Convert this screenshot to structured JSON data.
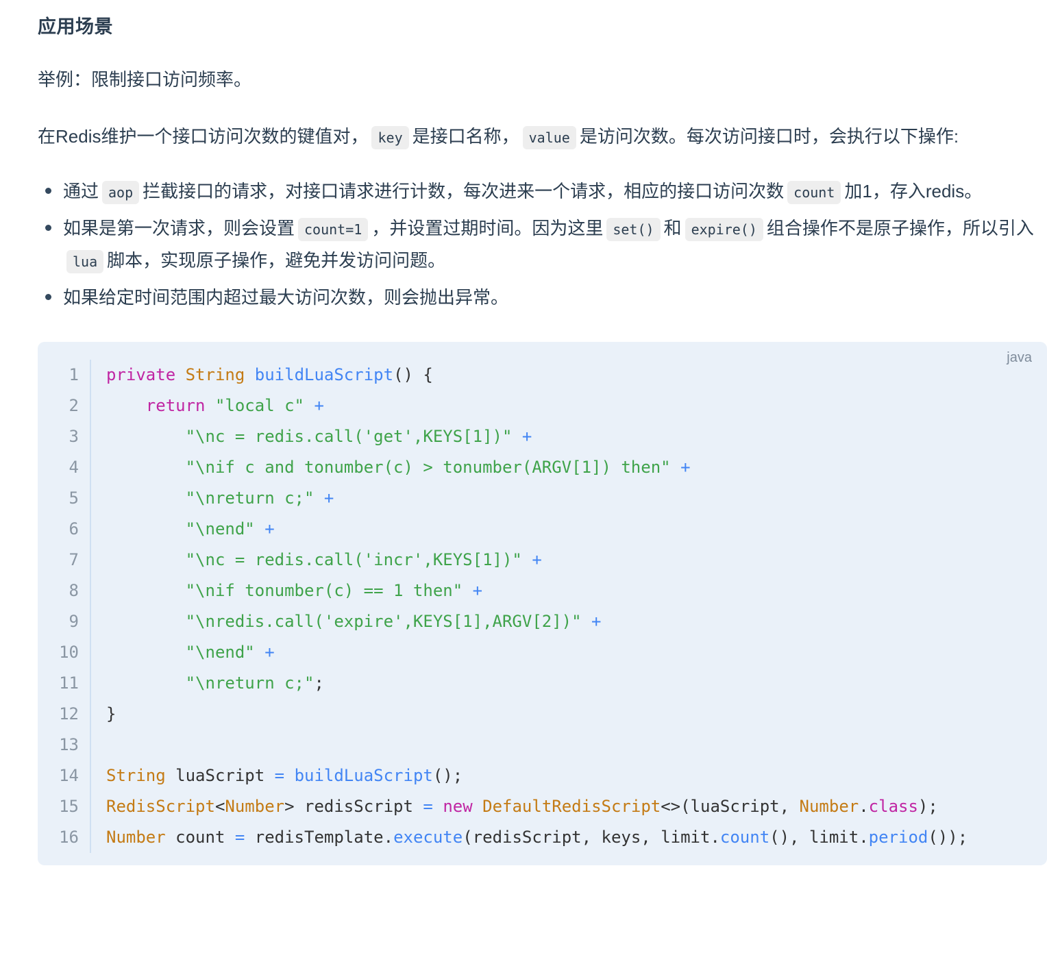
{
  "article": {
    "heading": "应用场景",
    "intro": "举例：限制接口访问频率。",
    "paragraph": {
      "part1": "在Redis维护一个接口访问次数的键值对，",
      "chip1": "key",
      "part2": "是接口名称，",
      "chip2": "value",
      "part3": "是访问次数。每次访问接口时，会执行以下操作:"
    },
    "bullets": [
      {
        "part1": "通过",
        "chip1": "aop",
        "part2": "拦截接口的请求，对接口请求进行计数，每次进来一个请求，相应的接口访问次数",
        "chip2": "count",
        "part3": "加1，存入redis。"
      },
      {
        "part1": "如果是第一次请求，则会设置",
        "chip1": "count=1",
        "part2": "，并设置过期时间。因为这里",
        "chip2": "set()",
        "part3": "和",
        "chip3": "expire()",
        "part4": "组合操作不是原子操作，所以引入",
        "chip4": "lua",
        "part5": "脚本，实现原子操作，避免并发访问问题。"
      },
      {
        "part1": "如果给定时间范围内超过最大访问次数，则会抛出异常。"
      }
    ]
  },
  "code_block": {
    "language_label": "java",
    "line_numbers": [
      "1",
      "2",
      "3",
      "4",
      "5",
      "6",
      "7",
      "8",
      "9",
      "10",
      "11",
      "12",
      "13",
      "14",
      "15",
      "16"
    ],
    "lines": [
      {
        "n": "1",
        "text": "private String buildLuaScript() {"
      },
      {
        "n": "2",
        "text": "    return \"local c\" +"
      },
      {
        "n": "3",
        "text": "        \"\\nc = redis.call('get',KEYS[1])\" +"
      },
      {
        "n": "4",
        "text": "        \"\\nif c and tonumber(c) > tonumber(ARGV[1]) then\" +"
      },
      {
        "n": "5",
        "text": "        \"\\nreturn c;\" +"
      },
      {
        "n": "6",
        "text": "        \"\\nend\" +"
      },
      {
        "n": "7",
        "text": "        \"\\nc = redis.call('incr',KEYS[1])\" +"
      },
      {
        "n": "8",
        "text": "        \"\\nif tonumber(c) == 1 then\" +"
      },
      {
        "n": "9",
        "text": "        \"\\nredis.call('expire',KEYS[1],ARGV[2])\" +"
      },
      {
        "n": "10",
        "text": "        \"\\nend\" +"
      },
      {
        "n": "11",
        "text": "        \"\\nreturn c;\";"
      },
      {
        "n": "12",
        "text": "}"
      },
      {
        "n": "13",
        "text": ""
      },
      {
        "n": "14",
        "text": "String luaScript = buildLuaScript();"
      },
      {
        "n": "15",
        "text": "RedisScript<Number> redisScript = new DefaultRedisScript<>(luaScript, Number.class);"
      },
      {
        "n": "16",
        "text": "Number count = redisTemplate.execute(redisScript, keys, limit.count(), limit.period());"
      }
    ],
    "tokens": {
      "l1": [
        [
          "private",
          "kw"
        ],
        [
          " ",
          "plain"
        ],
        [
          "String",
          "type"
        ],
        [
          " ",
          "plain"
        ],
        [
          "buildLuaScript",
          "fn"
        ],
        [
          "() {",
          "plain"
        ]
      ],
      "l2": [
        [
          "    ",
          "plain"
        ],
        [
          "return",
          "kw"
        ],
        [
          " ",
          "plain"
        ],
        [
          "\"local c\"",
          "str"
        ],
        [
          " ",
          "plain"
        ],
        [
          "+",
          "op"
        ]
      ],
      "l3": [
        [
          "        ",
          "plain"
        ],
        [
          "\"\\nc = redis.call('get',KEYS[1])\"",
          "str"
        ],
        [
          " ",
          "plain"
        ],
        [
          "+",
          "op"
        ]
      ],
      "l4": [
        [
          "        ",
          "plain"
        ],
        [
          "\"\\nif c and tonumber(c) > tonumber(ARGV[1]) then\"",
          "str"
        ],
        [
          " ",
          "plain"
        ],
        [
          "+",
          "op"
        ]
      ],
      "l5": [
        [
          "        ",
          "plain"
        ],
        [
          "\"\\nreturn c;\"",
          "str"
        ],
        [
          " ",
          "plain"
        ],
        [
          "+",
          "op"
        ]
      ],
      "l6": [
        [
          "        ",
          "plain"
        ],
        [
          "\"\\nend\"",
          "str"
        ],
        [
          " ",
          "plain"
        ],
        [
          "+",
          "op"
        ]
      ],
      "l7": [
        [
          "        ",
          "plain"
        ],
        [
          "\"\\nc = redis.call('incr',KEYS[1])\"",
          "str"
        ],
        [
          " ",
          "plain"
        ],
        [
          "+",
          "op"
        ]
      ],
      "l8": [
        [
          "        ",
          "plain"
        ],
        [
          "\"\\nif tonumber(c) == 1 then\"",
          "str"
        ],
        [
          " ",
          "plain"
        ],
        [
          "+",
          "op"
        ]
      ],
      "l9": [
        [
          "        ",
          "plain"
        ],
        [
          "\"\\nredis.call('expire',KEYS[1],ARGV[2])\"",
          "str"
        ],
        [
          " ",
          "plain"
        ],
        [
          "+",
          "op"
        ]
      ],
      "l10": [
        [
          "        ",
          "plain"
        ],
        [
          "\"\\nend\"",
          "str"
        ],
        [
          " ",
          "plain"
        ],
        [
          "+",
          "op"
        ]
      ],
      "l11": [
        [
          "        ",
          "plain"
        ],
        [
          "\"\\nreturn c;\"",
          "str"
        ],
        [
          ";",
          "plain"
        ]
      ],
      "l12": [
        [
          "}",
          "plain"
        ]
      ],
      "l13": [
        [
          "",
          "plain"
        ]
      ],
      "l14": [
        [
          "String",
          "type"
        ],
        [
          " luaScript ",
          "plain"
        ],
        [
          "=",
          "op"
        ],
        [
          " ",
          "plain"
        ],
        [
          "buildLuaScript",
          "fn"
        ],
        [
          "();",
          "plain"
        ]
      ],
      "l15": [
        [
          "RedisScript",
          "type"
        ],
        [
          "<",
          "plain"
        ],
        [
          "Number",
          "type"
        ],
        [
          "> redisScript ",
          "plain"
        ],
        [
          "=",
          "op"
        ],
        [
          " ",
          "plain"
        ],
        [
          "new",
          "kw"
        ],
        [
          " ",
          "plain"
        ],
        [
          "DefaultRedisScript",
          "type"
        ],
        [
          "<>(luaScript, ",
          "plain"
        ],
        [
          "Number",
          "type"
        ],
        [
          ".",
          "plain"
        ],
        [
          "class",
          "kw"
        ],
        [
          ");",
          "plain"
        ]
      ],
      "l16": [
        [
          "Number",
          "type"
        ],
        [
          " count ",
          "plain"
        ],
        [
          "=",
          "op"
        ],
        [
          " redisTemplate.",
          "plain"
        ],
        [
          "execute",
          "fn"
        ],
        [
          "(redisScript, keys, limit.",
          "plain"
        ],
        [
          "count",
          "fn"
        ],
        [
          "(), limit.",
          "plain"
        ],
        [
          "period",
          "fn"
        ],
        [
          "());",
          "plain"
        ]
      ]
    }
  },
  "fab": {
    "icon": "chat-bubble-icon"
  },
  "colors": {
    "text": "#2c3e50",
    "code_bg": "#eaf1f9",
    "chip_bg": "#eeeeee",
    "gutter_border": "#cfe0f2",
    "gutter_text": "#8a96a3",
    "keyword": "#c026a3",
    "type": "#c47b15",
    "function": "#4285f4",
    "string": "#3fa34a",
    "operator": "#4285f4",
    "accent": "#3a97e8"
  }
}
